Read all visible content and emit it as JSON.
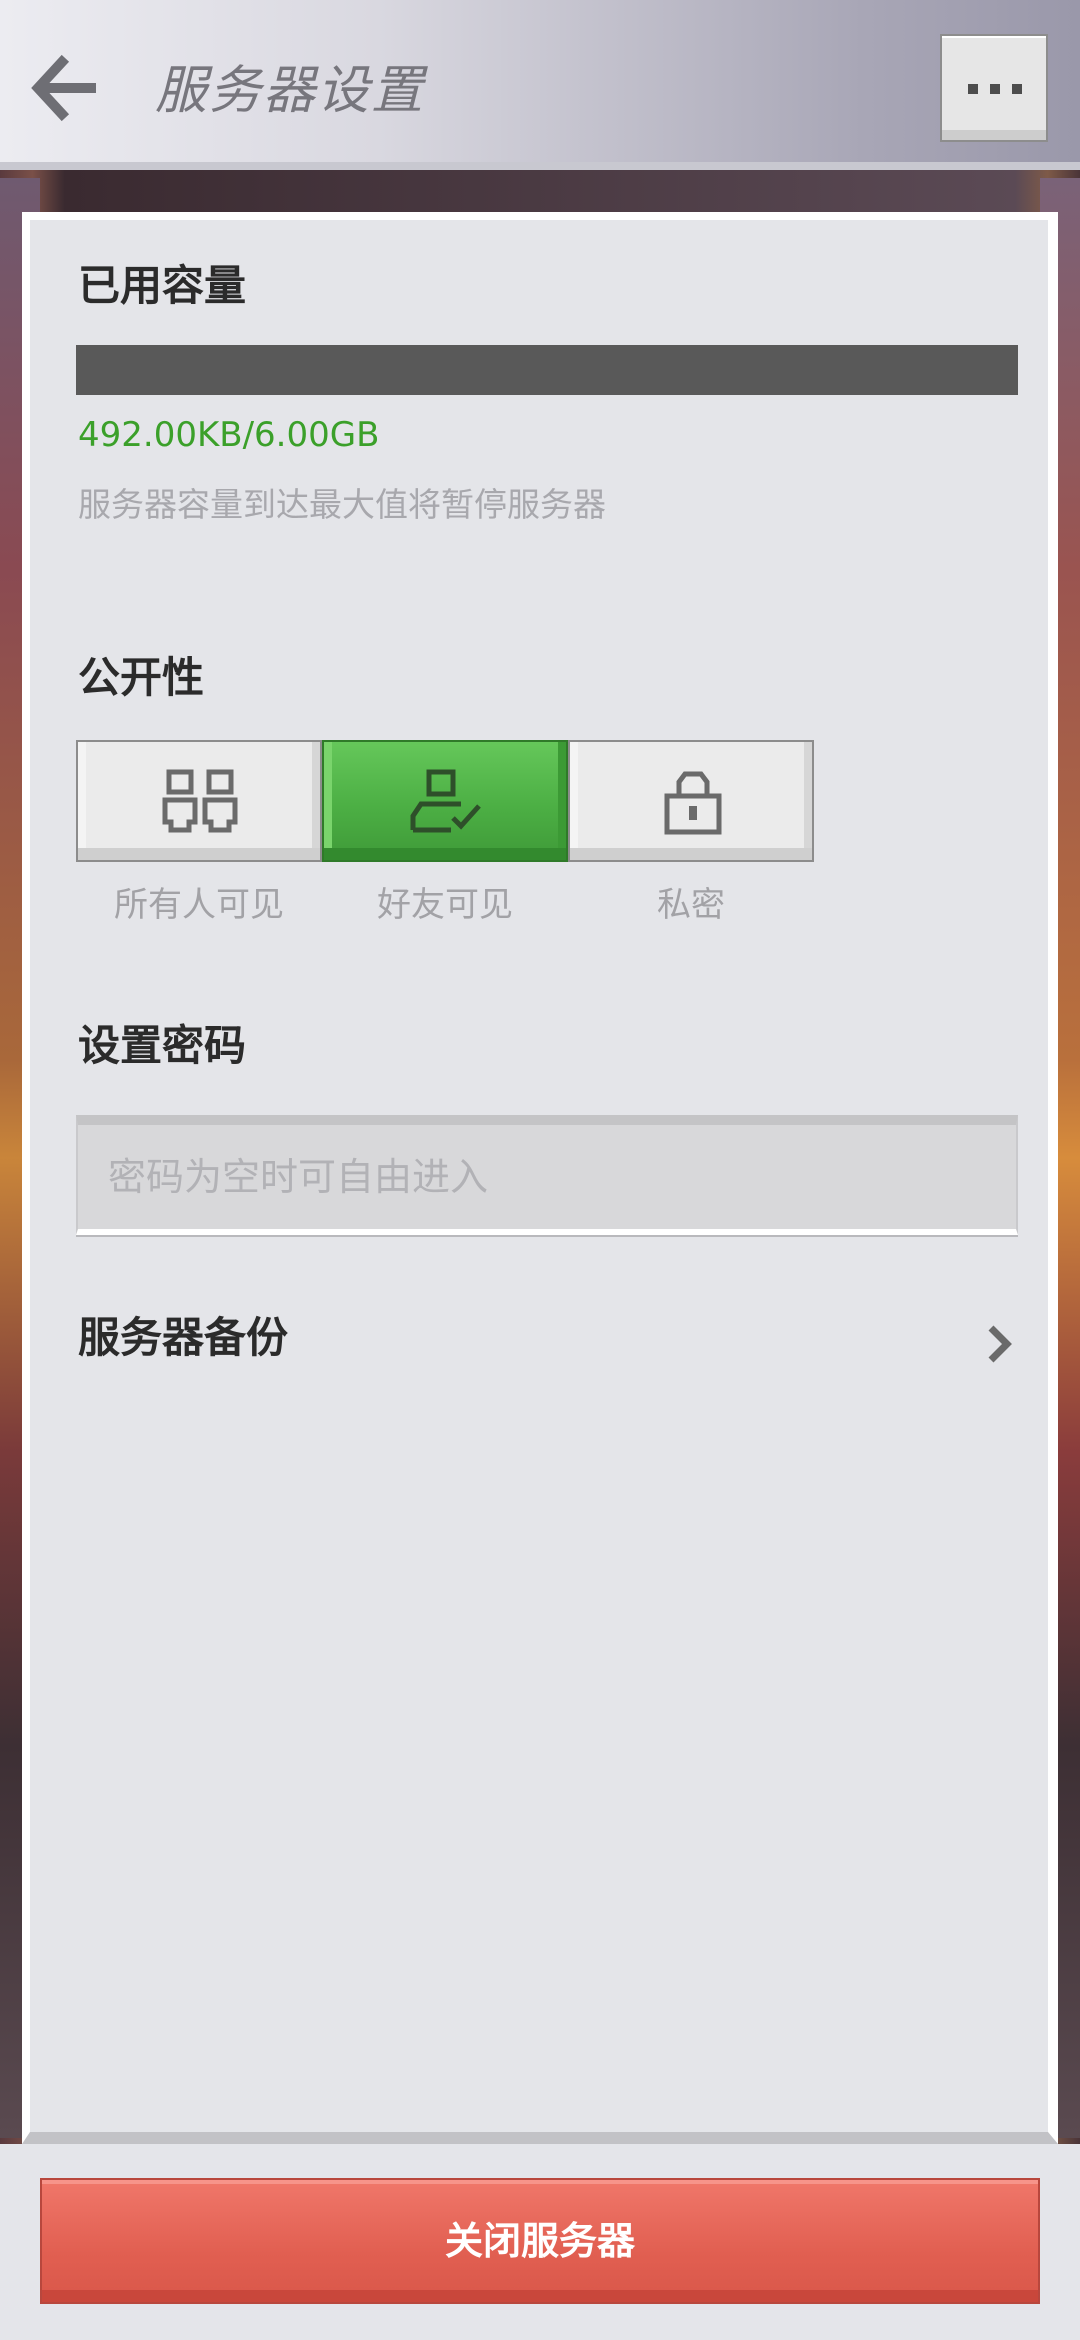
{
  "header": {
    "back_icon": "arrow-left-icon",
    "title": "服务器设置",
    "more_icon": "more-dots-icon"
  },
  "capacity": {
    "title": "已用容量",
    "used_fraction": 0.0,
    "text": "492.00KB/6.00GB",
    "hint": "服务器容量到达最大值将暂停服务器"
  },
  "visibility": {
    "title": "公开性",
    "selected": "friends",
    "options": [
      {
        "id": "public",
        "label": "所有人可见",
        "icon": "people-icon"
      },
      {
        "id": "friends",
        "label": "好友可见",
        "icon": "friend-check-icon"
      },
      {
        "id": "private",
        "label": "私密",
        "icon": "lock-icon"
      }
    ]
  },
  "password": {
    "title": "设置密码",
    "placeholder": "密码为空时可自由进入",
    "value": ""
  },
  "backup": {
    "title": "服务器备份",
    "icon": "chevron-right-icon"
  },
  "footer": {
    "close_label": "关闭服务器"
  },
  "colors": {
    "accent_green": "#4caf44",
    "capacity_text": "#3ba02a",
    "danger_red": "#e15f51",
    "bar_track": "#595959"
  }
}
